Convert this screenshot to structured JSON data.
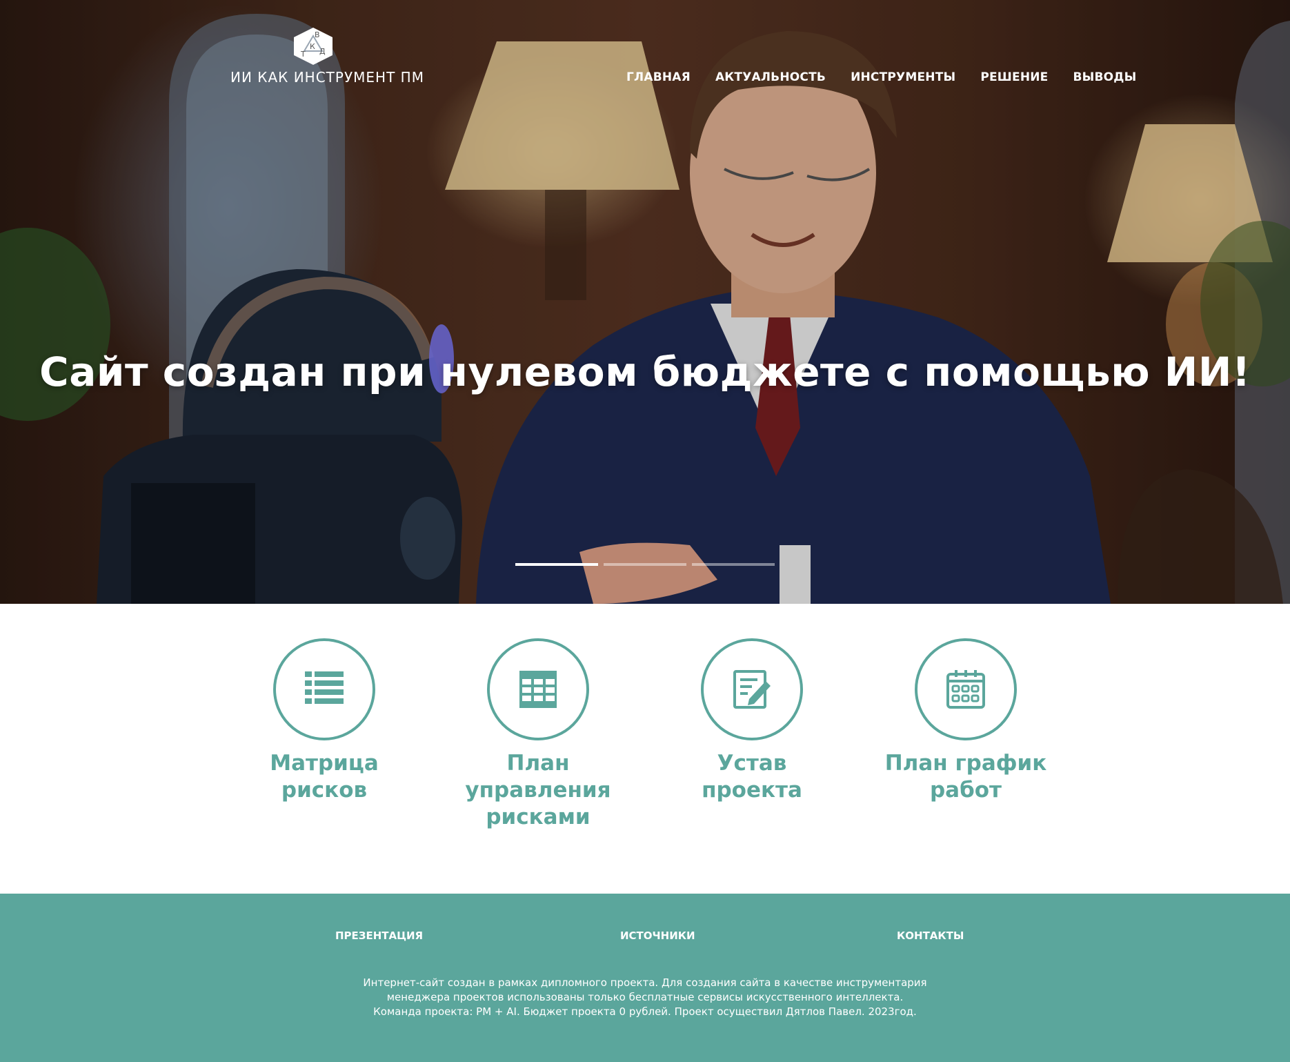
{
  "logo": {
    "text": "ИИ КАК ИНСТРУМЕНТ ПМ",
    "letters": [
      "В",
      "К",
      "Т",
      "Д"
    ]
  },
  "nav": {
    "items": [
      "ГЛАВНАЯ",
      "АКТУАЛЬНОСТЬ",
      "ИНСТРУМЕНТЫ",
      "РЕШЕНИЕ",
      "ВЫВОДЫ"
    ]
  },
  "hero": {
    "title": "Сайт создан при нулевом бюджете с помощью ИИ!",
    "slides_total": 3,
    "active_slide": 1
  },
  "features": [
    {
      "label": "Матрица рисков",
      "icon": "list-table-icon"
    },
    {
      "label": "План управления рисками",
      "icon": "grid-table-icon"
    },
    {
      "label": "Устав проекта",
      "icon": "document-edit-icon"
    },
    {
      "label": "План график работ",
      "icon": "calendar-icon"
    }
  ],
  "footer": {
    "links": [
      "ПРЕЗЕНТАЦИЯ",
      "ИСТОЧНИКИ",
      "КОНТАКТЫ"
    ],
    "text": [
      "Интернет-сайт создан в рамках дипломного проекта. Для создания сайта в качестве инструментария",
      "менеджера проектов использованы только бесплатные сервисы искусственного интеллекта.",
      "Команда проекта: PM + AI. Бюджет проекта 0 рублей. Проект осуществил Дятлов Павел. 2023год."
    ]
  },
  "colors": {
    "accent": "#5ba69c",
    "hero_text": "#ffffff",
    "footer_bg": "#5ba69c"
  }
}
